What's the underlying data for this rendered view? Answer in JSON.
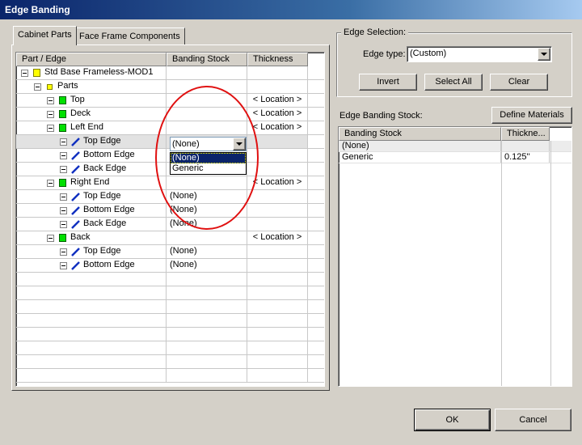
{
  "window": {
    "title": "Edge Banding"
  },
  "tabs": [
    {
      "label": "Cabinet Parts",
      "active": true
    },
    {
      "label": "Face Frame Components",
      "active": false
    }
  ],
  "grid": {
    "columns": [
      "Part / Edge",
      "Banding Stock",
      "Thickness"
    ],
    "rows": [
      {
        "label": "Std Base Frameless-MOD1",
        "level": 0,
        "icon": "yellow-box-icon",
        "stock": "",
        "thickness": ""
      },
      {
        "label": "Parts",
        "level": 1,
        "icon": "small-yellow-box-icon",
        "stock": "",
        "thickness": ""
      },
      {
        "label": "Top",
        "level": 2,
        "icon": "green-part-icon",
        "stock": "",
        "thickness": "< Location >"
      },
      {
        "label": "Deck",
        "level": 2,
        "icon": "green-part-icon",
        "stock": "",
        "thickness": "< Location >"
      },
      {
        "label": "Left End",
        "level": 2,
        "icon": "green-part-icon",
        "stock": "",
        "thickness": "< Location >"
      },
      {
        "label": "Top Edge",
        "level": 3,
        "icon": "edge-icon",
        "stock": "",
        "thickness": ""
      },
      {
        "label": "Bottom Edge",
        "level": 3,
        "icon": "edge-icon",
        "stock": "",
        "thickness": ""
      },
      {
        "label": "Back Edge",
        "level": 3,
        "icon": "edge-icon",
        "stock": "",
        "thickness": ""
      },
      {
        "label": "Right End",
        "level": 2,
        "icon": "green-part-icon",
        "stock": "",
        "thickness": "< Location >"
      },
      {
        "label": "Top Edge",
        "level": 3,
        "icon": "edge-icon",
        "stock": "(None)",
        "thickness": ""
      },
      {
        "label": "Bottom Edge",
        "level": 3,
        "icon": "edge-icon",
        "stock": "(None)",
        "thickness": ""
      },
      {
        "label": "Back Edge",
        "level": 3,
        "icon": "edge-icon",
        "stock": "(None)",
        "thickness": ""
      },
      {
        "label": "Back",
        "level": 2,
        "icon": "green-part-icon",
        "stock": "",
        "thickness": "< Location >"
      },
      {
        "label": "Top Edge",
        "level": 3,
        "icon": "edge-icon",
        "stock": "(None)",
        "thickness": ""
      },
      {
        "label": "Bottom Edge",
        "level": 3,
        "icon": "edge-icon",
        "stock": "(None)",
        "thickness": ""
      }
    ],
    "dropdown": {
      "value": "(None)",
      "options": [
        "(None)",
        "Generic"
      ]
    }
  },
  "edge_selection": {
    "title": "Edge Selection:",
    "edge_type_label": "Edge type:",
    "edge_type_value": "(Custom)",
    "invert_label": "Invert",
    "select_all_label": "Select All",
    "clear_label": "Clear"
  },
  "banding_stock": {
    "label": "Edge Banding Stock:",
    "define_label": "Define Materials",
    "columns": [
      "Banding Stock",
      "Thickne..."
    ],
    "rows": [
      {
        "name": "(None)",
        "thickness": ""
      },
      {
        "name": "Generic",
        "thickness": "0.125''"
      }
    ]
  },
  "footer": {
    "ok_label": "OK",
    "cancel_label": "Cancel"
  },
  "colors": {
    "title_bar": "#0a246a",
    "annotation": "#e01010",
    "selection": "#0a246a"
  }
}
